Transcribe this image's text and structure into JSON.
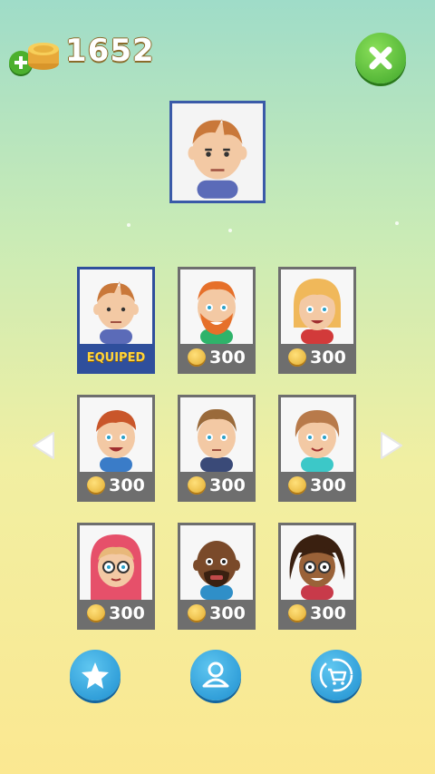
{
  "header": {
    "coins": "1652"
  },
  "grid": {
    "cards": [
      {
        "price": "",
        "label": "EQUIPED",
        "equipped": true
      },
      {
        "price": "300"
      },
      {
        "price": "300"
      },
      {
        "price": "300"
      },
      {
        "price": "300"
      },
      {
        "price": "300"
      },
      {
        "price": "300"
      },
      {
        "price": "300"
      },
      {
        "price": "300"
      }
    ]
  },
  "colors": {
    "accent_blue": "#2f4f9c",
    "coin_gold": "#f2c24a",
    "close_green": "#4cb02e",
    "button_blue": "#1e8fd0"
  },
  "icons": [
    "add-coins-icon",
    "coin-stack-icon",
    "close-icon",
    "arrow-left-icon",
    "arrow-right-icon",
    "star-icon",
    "profile-icon",
    "shop-cart-icon"
  ]
}
